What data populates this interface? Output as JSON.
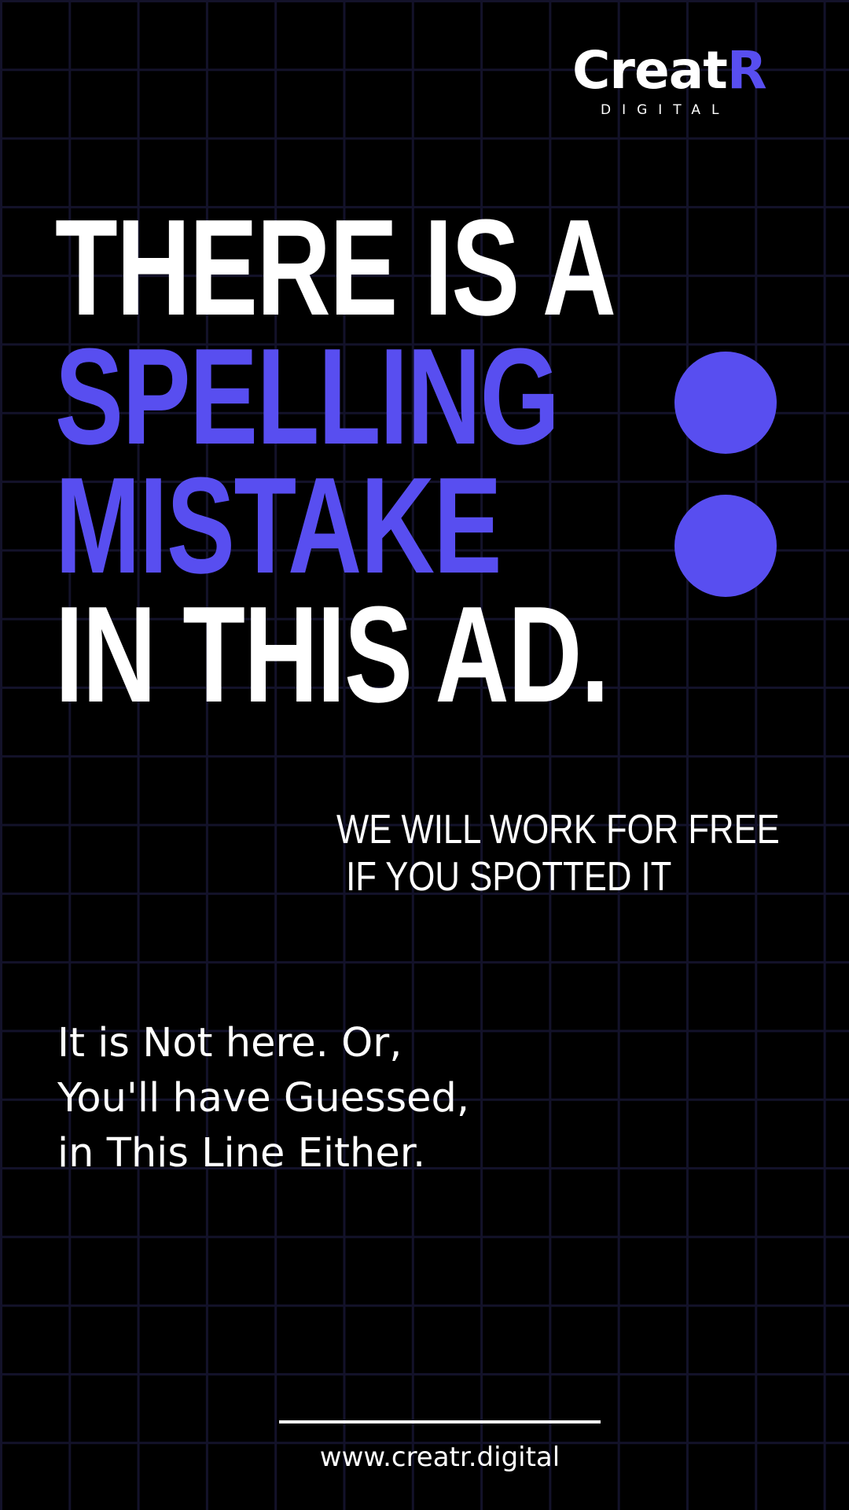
{
  "brand": {
    "logo_main": "Creat",
    "logo_accent": "R",
    "logo_sub": "DIGITAL"
  },
  "headline": {
    "line1": "THERE IS A",
    "line2": "SPELLING",
    "line3": "MISTAKE",
    "line4": "IN THIS AD."
  },
  "offer": {
    "line1": "WE WILL WORK FOR FREE",
    "line2": " IF YOU SPOTTED IT"
  },
  "body_copy": {
    "line1": "It is Not here. Or,",
    "line2": "You'll have Guessed,",
    "line3": "in This Line Either."
  },
  "footer": {
    "website": "www.creatr.digital"
  },
  "colors": {
    "background": "#000000",
    "accent": "#584ef0",
    "text": "#ffffff",
    "grid": "#13122a"
  }
}
